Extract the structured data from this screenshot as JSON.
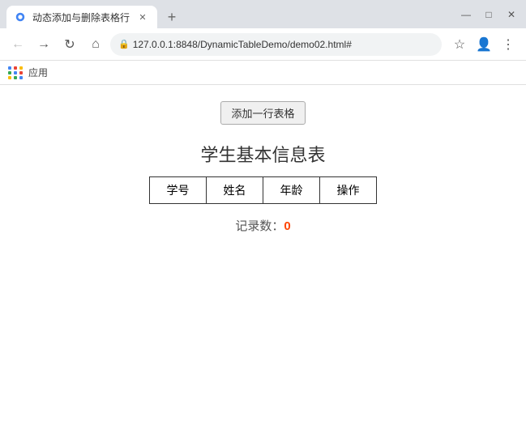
{
  "browser": {
    "tab_title": "动态添加与删除表格行",
    "url": "127.0.0.1:8848/DynamicTableDemo/demo02.html#",
    "bookmarks_label": "应用"
  },
  "page": {
    "add_button_label": "添加一行表格",
    "table_title": "学生基本信息表",
    "columns": [
      "学号",
      "姓名",
      "年龄",
      "操作"
    ],
    "record_label": "记录数：",
    "record_count": "0"
  },
  "icons": {
    "back": "←",
    "forward": "→",
    "reload": "↻",
    "home": "⌂",
    "lock": "🔒",
    "star": "☆",
    "account": "👤",
    "more": "⋮",
    "minimize": "—",
    "maximize": "□",
    "close": "✕",
    "new_tab": "+",
    "tab_close": "✕"
  }
}
